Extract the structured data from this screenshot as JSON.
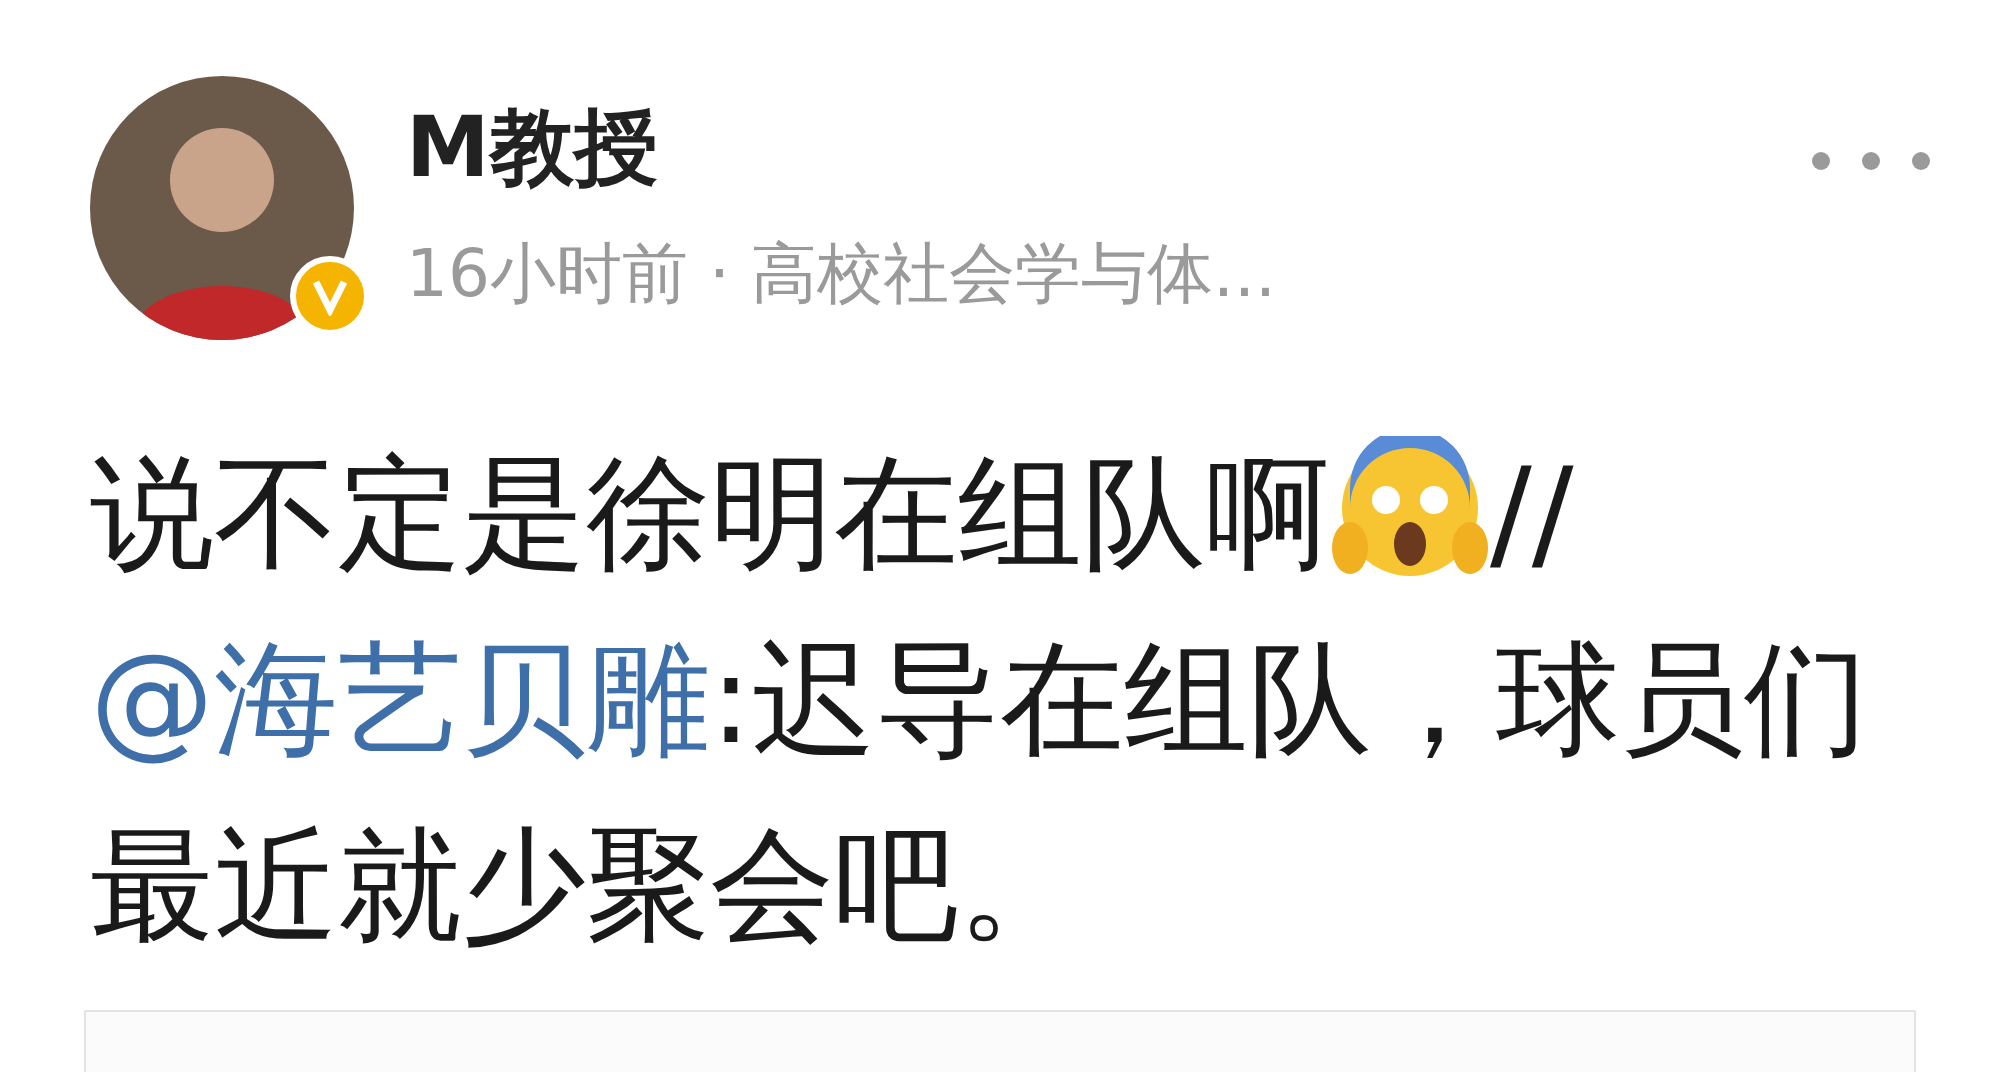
{
  "author": {
    "name": "M教授",
    "verified": true,
    "meta": "16小时前 · 高校社会学与体..."
  },
  "body": [
    {
      "kind": "text",
      "text": "说不定是徐明在组队啊"
    },
    {
      "kind": "emoji"
    },
    {
      "kind": "text",
      "text": "//"
    },
    {
      "kind": "mention",
      "text": "@海艺贝雕"
    },
    {
      "kind": "text",
      "text": ":迟导在组队，球员们最近就少聚会吧。"
    }
  ]
}
